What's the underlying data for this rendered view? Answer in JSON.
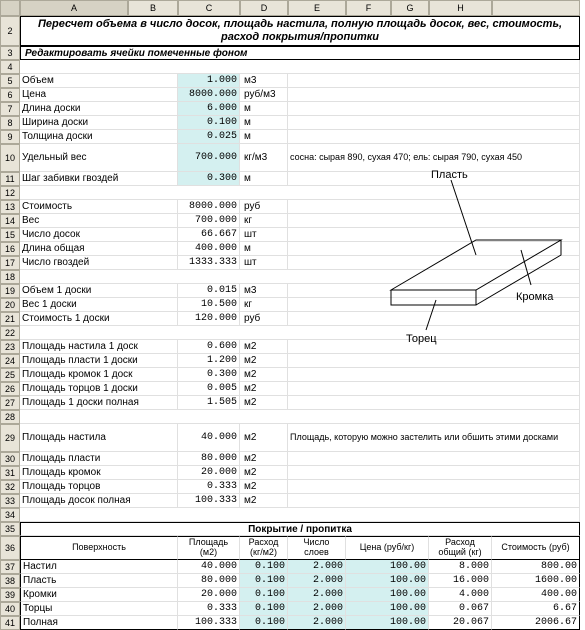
{
  "colheaders": [
    "A",
    "B",
    "C",
    "D",
    "E",
    "F",
    "G",
    "H"
  ],
  "rowheaders": [
    "2",
    "3",
    "4",
    "5",
    "6",
    "7",
    "8",
    "9",
    "10",
    "11",
    "12",
    "13",
    "14",
    "15",
    "16",
    "17",
    "18",
    "19",
    "20",
    "21",
    "22",
    "23",
    "24",
    "25",
    "26",
    "27",
    "28",
    "29",
    "30",
    "31",
    "32",
    "33",
    "34",
    "35",
    "36",
    "37",
    "38",
    "39",
    "40",
    "41"
  ],
  "title": "Пересчет объема в число досок, площадь настила, полную площадь досок, вес, стоимость, расход покрытия/пропитки",
  "subtitle": "Редактировать ячейки помеченные фоном",
  "inputs": [
    {
      "label": "Объем",
      "val": "1.000",
      "unit": "м3"
    },
    {
      "label": "Цена",
      "val": "8000.000",
      "unit": "руб/м3"
    },
    {
      "label": "Длина доски",
      "val": "6.000",
      "unit": "м"
    },
    {
      "label": "Ширина доски",
      "val": "0.100",
      "unit": "м"
    },
    {
      "label": "Толщина доски",
      "val": "0.025",
      "unit": "м"
    }
  ],
  "weight": {
    "label": "Удельный вес",
    "val": "700.000",
    "unit": "кг/м3",
    "note": "сосна: сырая 890, сухая 470; ель: сырая 790, сухая 450"
  },
  "nailstep": {
    "label": "Шаг забивки гвоздей",
    "val": "0.300",
    "unit": "м"
  },
  "calc1": [
    {
      "label": "Стоимость",
      "val": "8000.000",
      "unit": "руб"
    },
    {
      "label": "Вес",
      "val": "700.000",
      "unit": "кг"
    },
    {
      "label": "Число досок",
      "val": "66.667",
      "unit": "шт"
    },
    {
      "label": "Длина общая",
      "val": "400.000",
      "unit": "м"
    },
    {
      "label": "Число гвоздей",
      "val": "1333.333",
      "unit": "шт"
    }
  ],
  "calc2": [
    {
      "label": "Объем 1 доски",
      "val": "0.015",
      "unit": "м3"
    },
    {
      "label": "Вес 1 доски",
      "val": "10.500",
      "unit": "кг"
    },
    {
      "label": "Стоимость 1 доски",
      "val": "120.000",
      "unit": "руб"
    }
  ],
  "calc3": [
    {
      "label": "Площадь настила 1 доск",
      "val": "0.600",
      "unit": "м2"
    },
    {
      "label": "Площадь пласти 1 доски",
      "val": "1.200",
      "unit": "м2"
    },
    {
      "label": "Площадь кромок 1 доск",
      "val": "0.300",
      "unit": "м2"
    },
    {
      "label": "Площадь торцов 1 доски",
      "val": "0.005",
      "unit": "м2"
    },
    {
      "label": "Площадь 1 доски полная",
      "val": "1.505",
      "unit": "м2"
    }
  ],
  "floorarea": {
    "label": "Площадь настила",
    "val": "40.000",
    "unit": "м2",
    "note": "Площадь, которую можно застелить или обшить этими досками"
  },
  "calc4": [
    {
      "label": "Площадь пласти",
      "val": "80.000",
      "unit": "м2"
    },
    {
      "label": "Площадь кромок",
      "val": "20.000",
      "unit": "м2"
    },
    {
      "label": "Площадь торцов",
      "val": "0.333",
      "unit": "м2"
    },
    {
      "label": "Площадь досок полная",
      "val": "100.333",
      "unit": "м2"
    }
  ],
  "diagram": {
    "plast": "Пласть",
    "kromka": "Кромка",
    "torec": "Торец"
  },
  "coating": {
    "title": "Покрытие / пропитка",
    "headers": [
      "Поверхность",
      "Площадь (м2)",
      "Расход (кг/м2)",
      "Число слоев",
      "Цена (руб/кг)",
      "Расход общий (кг)",
      "Стоимость (руб)"
    ],
    "rows": [
      {
        "name": "Настил",
        "area": "40.000",
        "rate": "0.100",
        "layers": "2.000",
        "price": "100.00",
        "total": "8.000",
        "cost": "800.00"
      },
      {
        "name": "Пласть",
        "area": "80.000",
        "rate": "0.100",
        "layers": "2.000",
        "price": "100.00",
        "total": "16.000",
        "cost": "1600.00"
      },
      {
        "name": "Кромки",
        "area": "20.000",
        "rate": "0.100",
        "layers": "2.000",
        "price": "100.00",
        "total": "4.000",
        "cost": "400.00"
      },
      {
        "name": "Торцы",
        "area": "0.333",
        "rate": "0.100",
        "layers": "2.000",
        "price": "100.00",
        "total": "0.067",
        "cost": "6.67"
      },
      {
        "name": "Полная",
        "area": "100.333",
        "rate": "0.100",
        "layers": "2.000",
        "price": "100.00",
        "total": "20.067",
        "cost": "2006.67"
      }
    ]
  }
}
